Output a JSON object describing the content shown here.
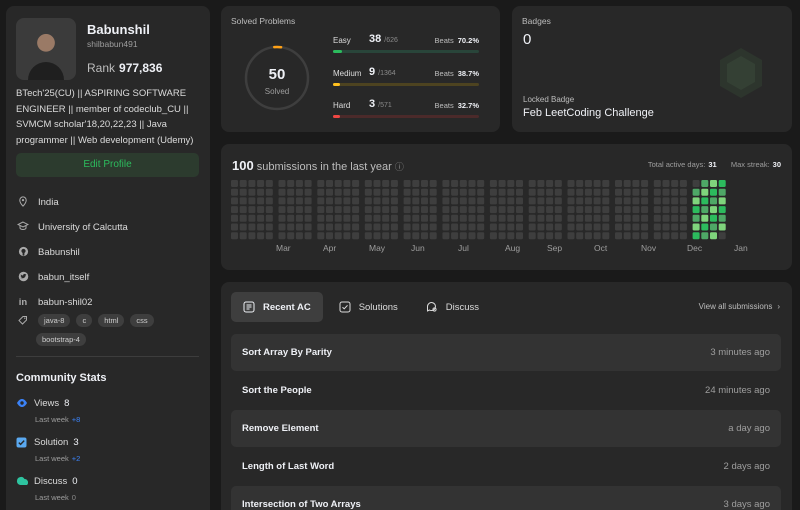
{
  "profile": {
    "name": "Babunshil",
    "handle": "shilbabun491",
    "rank_label": "Rank",
    "rank_value": "977,836",
    "bio": "BTech'25(CU) || ASPIRING SOFTWARE ENGINEER || member of codeclub_CU || SVMCM scholar'18,20,22,23 || Java programmer || Web development (Udemy)",
    "edit_label": "Edit Profile",
    "location": "India",
    "school": "University of Calcutta",
    "github": "Babunshil",
    "twitter": "babun_itself",
    "linkedin": "babun-shil02",
    "skills": [
      "java-8",
      "c",
      "html",
      "css",
      "bootstrap-4"
    ]
  },
  "community": {
    "title": "Community Stats",
    "stats": [
      {
        "label": "Views",
        "value": "8",
        "last_week_label": "Last week",
        "delta": "+8",
        "color": "#3b82f6"
      },
      {
        "label": "Solution",
        "value": "3",
        "last_week_label": "Last week",
        "delta": "+2",
        "color": "#3b82f6"
      },
      {
        "label": "Discuss",
        "value": "0",
        "last_week_label": "Last week",
        "delta": "0",
        "color": "#3b82f6"
      }
    ]
  },
  "solved": {
    "title": "Solved Problems",
    "total": "50",
    "total_label": "Solved",
    "difficulties": [
      {
        "name": "Easy",
        "count": "38",
        "total": "/626",
        "beats_label": "Beats",
        "beats": "70.2%",
        "fraction": 0.061,
        "color": "#2cbb5d",
        "track": "#29453a"
      },
      {
        "name": "Medium",
        "count": "9",
        "total": "/1364",
        "beats_label": "Beats",
        "beats": "38.7%",
        "fraction": 0.007,
        "color": "#ffc01e",
        "track": "#4d4320"
      },
      {
        "name": "Hard",
        "count": "3",
        "total": "/571",
        "beats_label": "Beats",
        "beats": "32.7%",
        "fraction": 0.005,
        "color": "#ef4743",
        "track": "#4b2a2a"
      }
    ]
  },
  "badges": {
    "title": "Badges",
    "count": "0",
    "locked_label": "Locked Badge",
    "locked_name": "Feb LeetCoding Challenge"
  },
  "heatmap": {
    "count": "100",
    "label": "submissions in the last year",
    "active_days_label": "Total active days:",
    "active_days": "31",
    "max_streak_label": "Max streak:",
    "max_streak": "30",
    "months": [
      "Mar",
      "Apr",
      "May",
      "Jun",
      "Jul",
      "Aug",
      "Sep",
      "Oct",
      "Nov",
      "Dec",
      "Jan"
    ],
    "empty_color": "#3e3e3e",
    "active_colors": [
      "#2cbb5d",
      "#4ea866",
      "#7fd47c"
    ]
  },
  "recent": {
    "tabs": [
      "Recent AC",
      "Solutions",
      "Discuss"
    ],
    "view_all": "View all submissions",
    "items": [
      {
        "title": "Sort Array By Parity",
        "time": "3 minutes ago"
      },
      {
        "title": "Sort the People",
        "time": "24 minutes ago"
      },
      {
        "title": "Remove Element",
        "time": "a day ago"
      },
      {
        "title": "Length of Last Word",
        "time": "2 days ago"
      },
      {
        "title": "Intersection of Two Arrays",
        "time": "3 days ago"
      }
    ]
  }
}
